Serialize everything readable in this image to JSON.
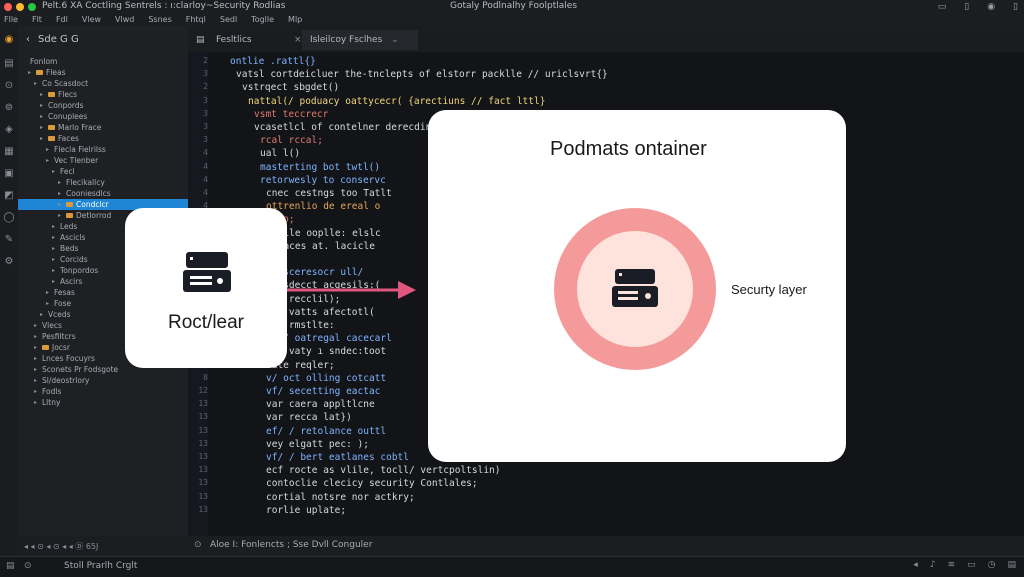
{
  "window": {
    "title": "Pelt.6 XA Coctling Sentrels : ı:clarloy~Security Rodlias",
    "center_title": "Gotaly Podlnalhy Foolptlales"
  },
  "menu": [
    "Flle",
    "Flt",
    "Fdl",
    "Vlew",
    "Vlwd",
    "Ssnes",
    "Fhtql",
    "Sedl",
    "Toglle",
    "Mlp"
  ],
  "sidebar": {
    "header": "Sde  G  G",
    "tree": [
      {
        "label": "Fonlom",
        "indent": 0,
        "arrow": false,
        "folder": false
      },
      {
        "label": "Fleas",
        "indent": 1,
        "arrow": true,
        "folder": true
      },
      {
        "label": "Co Scasdoct",
        "indent": 2,
        "arrow": true,
        "folder": false
      },
      {
        "label": "Flecs",
        "indent": 3,
        "arrow": true,
        "folder": true
      },
      {
        "label": "Conpords",
        "indent": 3,
        "arrow": true,
        "folder": false
      },
      {
        "label": "Conuplees",
        "indent": 3,
        "arrow": true,
        "folder": false
      },
      {
        "label": "Marlo Frace",
        "indent": 3,
        "arrow": true,
        "folder": true
      },
      {
        "label": "Faces",
        "indent": 3,
        "arrow": true,
        "folder": true
      },
      {
        "label": "Flecla Fielrilss",
        "indent": 4,
        "arrow": true,
        "folder": false
      },
      {
        "label": "Vec Tlenber",
        "indent": 4,
        "arrow": true,
        "folder": false
      },
      {
        "label": "Fecl",
        "indent": 5,
        "arrow": true,
        "folder": false
      },
      {
        "label": "Flecikallcy",
        "indent": 6,
        "arrow": true,
        "folder": false
      },
      {
        "label": "Cooniesdlcs",
        "indent": 6,
        "arrow": true,
        "folder": false
      },
      {
        "label": "Condclcr",
        "indent": 6,
        "arrow": true,
        "folder": true,
        "selected": true
      },
      {
        "label": "Detlorrod",
        "indent": 6,
        "arrow": true,
        "folder": true
      },
      {
        "label": "Leds",
        "indent": 5,
        "arrow": true,
        "folder": false
      },
      {
        "label": "Ascicls",
        "indent": 5,
        "arrow": true,
        "folder": false
      },
      {
        "label": "Beds",
        "indent": 5,
        "arrow": true,
        "folder": false
      },
      {
        "label": "Corcids",
        "indent": 5,
        "arrow": true,
        "folder": false
      },
      {
        "label": "Tonpordos",
        "indent": 5,
        "arrow": true,
        "folder": false
      },
      {
        "label": "Ascirs",
        "indent": 5,
        "arrow": true,
        "folder": false
      },
      {
        "label": "Fesas",
        "indent": 4,
        "arrow": true,
        "folder": false
      },
      {
        "label": "Fose",
        "indent": 4,
        "arrow": true,
        "folder": false
      },
      {
        "label": "Vceds",
        "indent": 3,
        "arrow": true,
        "folder": false
      },
      {
        "label": "Vlecs",
        "indent": 2,
        "arrow": true,
        "folder": false
      },
      {
        "label": "Pesfiltcrs",
        "indent": 2,
        "arrow": true,
        "folder": false
      },
      {
        "label": "Jocsr",
        "indent": 2,
        "arrow": true,
        "folder": true
      },
      {
        "label": "Lnces Focuyrs",
        "indent": 2,
        "arrow": true,
        "folder": false
      },
      {
        "label": "Sconets Pr Fodsgote",
        "indent": 2,
        "arrow": true,
        "folder": false
      },
      {
        "label": "Sl/deostrlory",
        "indent": 2,
        "arrow": true,
        "folder": false
      },
      {
        "label": "Fodls",
        "indent": 2,
        "arrow": true,
        "folder": false
      },
      {
        "label": "Lltny",
        "indent": 2,
        "arrow": true,
        "folder": false
      }
    ],
    "footer": "◂  ◂  ⊙  ◂  ⊙ ◂ ◂ Ⓓ 65J"
  },
  "tabs": [
    {
      "label": "Fesltlics",
      "active": false
    },
    {
      "label": "Isleilcoy Fsclhes",
      "active": true
    }
  ],
  "code": [
    {
      "ln": "2",
      "text": "ontlie .rattl{}",
      "color": "#7fb3ff",
      "indent": 1
    },
    {
      "ln": "3",
      "text": "vatsl cortdeicluer the-tnclepts of elstorr packlle // uriclsvrt{}",
      "color": "#d6d9de",
      "indent": 2
    },
    {
      "ln": "2",
      "text": "vstrqect sbgdet()",
      "color": "#d6d9de",
      "indent": 3
    },
    {
      "ln": "3",
      "text": "nattal(/ poduacy oattycecr( {arectiuns // fact lttl}",
      "color": "#f0d67a",
      "indent": 4
    },
    {
      "ln": "3",
      "text": "vsmt teccrecr",
      "color": "#e27a6f",
      "indent": 5
    },
    {
      "ln": "3",
      "text": "vcasetlcl of contelner derecdins",
      "color": "#d6d9de",
      "indent": 5
    },
    {
      "ln": "3",
      "text": "rcal rccal;",
      "color": "#e27a6f",
      "indent": 6
    },
    {
      "ln": "4",
      "text": "ual l()",
      "color": "#d6d9de",
      "indent": 6
    },
    {
      "ln": "4",
      "text": "masterting bot twtl()",
      "color": "#7fb3ff",
      "indent": 6
    },
    {
      "ln": "4",
      "text": "retorwesly to conservc",
      "color": "#7fb3ff",
      "indent": 6
    },
    {
      "ln": "4",
      "text": "cnec cestngs too Tatlt",
      "color": "#d6d9de",
      "indent": 7
    },
    {
      "ln": "4",
      "text": "ottrenlio de ereal o",
      "color": "#e8a35a",
      "indent": 7
    },
    {
      "ln": "4",
      "text": "yodo;",
      "color": "#e27a6f",
      "indent": 7
    },
    {
      "ln": "4",
      "text": "ealle ooplle: elslc",
      "color": "#d6d9de",
      "indent": 8
    },
    {
      "ln": "4",
      "text": "opaces at. lacicle",
      "color": "#d6d9de",
      "indent": 8
    },
    {
      "ln": "4",
      "text": "}",
      "color": "#d6d9de",
      "indent": 7
    },
    {
      "ln": "4",
      "text": "// sceresocr ull/",
      "color": "#7fb3ff",
      "indent": 7
    },
    {
      "ln": "4",
      "text": "sf sdecct acgesils:(",
      "color": "#d6d9de",
      "indent": 7
    },
    {
      "ln": "4",
      "text": "vat recclil);",
      "color": "#d6d9de",
      "indent": 7
    },
    {
      "ln": "4",
      "text": "vst vatts afectotl(",
      "color": "#d6d9de",
      "indent": 7
    },
    {
      "ln": "4",
      "text": "taf rmstlte:",
      "color": "#d6d9de",
      "indent": 7
    },
    {
      "ln": "8",
      "text": "of / oatregal cacecarl",
      "color": "#7fb3ff",
      "indent": 7
    },
    {
      "ln": "8",
      "text": "vat vaty ı sndec:toot",
      "color": "#d6d9de",
      "indent": 7
    },
    {
      "ln": "8",
      "text": "vate reqler;",
      "color": "#d6d9de",
      "indent": 7
    },
    {
      "ln": "8",
      "text": "v/ oct olling cotcatt",
      "color": "#7fb3ff",
      "indent": 7
    },
    {
      "ln": "12",
      "text": "vf/ secetting eactac",
      "color": "#7fb3ff",
      "indent": 7
    },
    {
      "ln": "13",
      "text": "var caera appltlcne",
      "color": "#d6d9de",
      "indent": 7
    },
    {
      "ln": "13",
      "text": "var recca lat})",
      "color": "#d6d9de",
      "indent": 7
    },
    {
      "ln": "13",
      "text": "ef/ / retolance outtl",
      "color": "#7fb3ff",
      "indent": 7
    },
    {
      "ln": "13",
      "text": "vey elgatt pec: );",
      "color": "#d6d9de",
      "indent": 7
    },
    {
      "ln": "13",
      "text": "vf/ / bert eatlanes cobtl",
      "color": "#7fb3ff",
      "indent": 7
    },
    {
      "ln": "13",
      "text": "ecf rocte as vlile, tocll/ vertcpoltslin)",
      "color": "#d6d9de",
      "indent": 7
    },
    {
      "ln": "13",
      "text": "contoclie clecicy security Contlales;",
      "color": "#d6d9de",
      "indent": 7
    },
    {
      "ln": "13",
      "text": "cortial notsre nor actkry;",
      "color": "#d6d9de",
      "indent": 7
    },
    {
      "ln": "13",
      "text": "rorlie uplate;",
      "color": "#d6d9de",
      "indent": 7
    }
  ],
  "status": "Aloe I: Fonlencts ; Sse Dvll Conguler",
  "bottom": "Stoll Prarlh Crglt",
  "cards": {
    "left_label": "Roct/lear",
    "right_title": "Podmats ontainer",
    "security_label": "Securty layer"
  },
  "colors": {
    "accent": "#1f86d6",
    "ring": "#f59a9a",
    "ring_inner": "#fde3db",
    "arrow": "#e0567f"
  }
}
